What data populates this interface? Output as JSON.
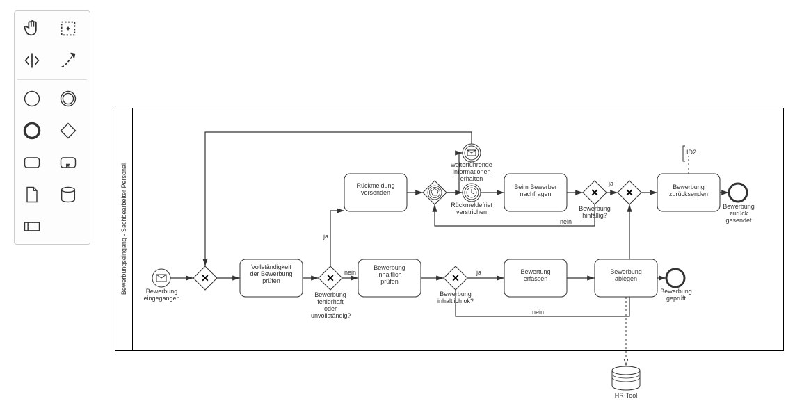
{
  "pool": {
    "title": "Bewerbungseingang -\nSachbearbeiter Personal"
  },
  "events": {
    "start": {
      "label": "Bewerbung\neingegangen"
    },
    "infoReceived": {
      "label": "weiterführende\nInformationen\nerhalten"
    },
    "deadline": {
      "label": "Rückmeldefrist\nverstrichen"
    },
    "endChecked": {
      "label": "Bewerbung\ngeprüft"
    },
    "endSent": {
      "label": "Bewerbung\nzurück\ngesendet"
    }
  },
  "tasks": {
    "checkComplete": "Vollständigkeit\nder Bewerbung\nprüfen",
    "sendFeedback": "Rückmeldung\nversenden",
    "checkContent": "Bewerbung\ninhaltlich\nprüfen",
    "askApplicant": "Beim Bewerber\nnachfragen",
    "recordEval": "Bewertung\nerfassen",
    "file": "Bewerbung\nablegen",
    "sendBack": "Bewerbung\nzurücksenden"
  },
  "gateways": {
    "faulty": {
      "label": "Bewerbung\nfehlerhaft\noder\nunvollständig?",
      "yes": "ja",
      "no": "nein"
    },
    "contentOk": {
      "label": "Bewerbung\ninhaltlich ok?",
      "yes": "ja",
      "no": "nein"
    },
    "hopeless": {
      "label": "Bewerbung\nhinfällig?",
      "yes": "ja",
      "no": "nein"
    }
  },
  "data": {
    "hrtool": "HR-Tool",
    "id2": "ID2"
  },
  "toolbox": [
    "hand",
    "lasso",
    "space",
    "connect",
    "event",
    "event-double",
    "event-bold",
    "gateway",
    "task",
    "subprocess",
    "data-object",
    "data-store",
    "participant"
  ],
  "chart_data": {
    "type": "bpmn",
    "pool": "Bewerbungseingang - Sachbearbeiter Personal",
    "nodes": [
      {
        "id": "start",
        "type": "startEvent",
        "subtype": "message",
        "label": "Bewerbung eingegangen"
      },
      {
        "id": "gw_merge1",
        "type": "exclusiveGateway"
      },
      {
        "id": "t_checkComplete",
        "type": "task",
        "label": "Vollständigkeit der Bewerbung prüfen"
      },
      {
        "id": "gw_faulty",
        "type": "exclusiveGateway",
        "label": "Bewerbung fehlerhaft oder unvollständig?"
      },
      {
        "id": "t_sendFeedback",
        "type": "task",
        "label": "Rückmeldung versenden"
      },
      {
        "id": "gw_event",
        "type": "eventBasedGateway"
      },
      {
        "id": "ev_info",
        "type": "intermediateCatchEvent",
        "subtype": "message",
        "label": "weiterführende Informationen erhalten"
      },
      {
        "id": "ev_deadline",
        "type": "intermediateCatchEvent",
        "subtype": "timer",
        "label": "Rückmeldefrist verstrichen"
      },
      {
        "id": "t_askApplicant",
        "type": "task",
        "label": "Beim Bewerber nachfragen"
      },
      {
        "id": "gw_hopeless",
        "type": "exclusiveGateway",
        "label": "Bewerbung hinfällig?"
      },
      {
        "id": "gw_merge2",
        "type": "exclusiveGateway"
      },
      {
        "id": "t_sendBack",
        "type": "task",
        "label": "Bewerbung zurücksenden"
      },
      {
        "id": "end_sent",
        "type": "endEvent",
        "label": "Bewerbung zurück gesendet"
      },
      {
        "id": "t_checkContent",
        "type": "task",
        "label": "Bewerbung inhaltlich prüfen"
      },
      {
        "id": "gw_contentOk",
        "type": "exclusiveGateway",
        "label": "Bewerbung inhaltlich ok?"
      },
      {
        "id": "t_recordEval",
        "type": "task",
        "label": "Bewertung erfassen"
      },
      {
        "id": "t_file",
        "type": "task",
        "label": "Bewerbung ablegen"
      },
      {
        "id": "end_checked",
        "type": "endEvent",
        "label": "Bewerbung geprüft"
      },
      {
        "id": "ds_hrtool",
        "type": "dataStore",
        "label": "HR-Tool"
      },
      {
        "id": "txt_id2",
        "type": "textAnnotation",
        "label": "ID2"
      }
    ],
    "flows": [
      {
        "from": "start",
        "to": "gw_merge1"
      },
      {
        "from": "gw_merge1",
        "to": "t_checkComplete"
      },
      {
        "from": "t_checkComplete",
        "to": "gw_faulty"
      },
      {
        "from": "gw_faulty",
        "to": "t_sendFeedback",
        "label": "ja"
      },
      {
        "from": "gw_faulty",
        "to": "t_checkContent",
        "label": "nein"
      },
      {
        "from": "t_sendFeedback",
        "to": "gw_event"
      },
      {
        "from": "gw_event",
        "to": "ev_info"
      },
      {
        "from": "gw_event",
        "to": "ev_deadline"
      },
      {
        "from": "ev_info",
        "to": "gw_merge1"
      },
      {
        "from": "ev_deadline",
        "to": "t_askApplicant"
      },
      {
        "from": "t_askApplicant",
        "to": "gw_hopeless"
      },
      {
        "from": "gw_hopeless",
        "to": "gw_merge2",
        "label": "ja"
      },
      {
        "from": "gw_hopeless",
        "to": "gw_event",
        "label": "nein"
      },
      {
        "from": "gw_merge2",
        "to": "t_sendBack"
      },
      {
        "from": "t_sendBack",
        "to": "end_sent"
      },
      {
        "from": "t_checkContent",
        "to": "gw_contentOk"
      },
      {
        "from": "gw_contentOk",
        "to": "t_recordEval",
        "label": "ja"
      },
      {
        "from": "gw_contentOk",
        "to": "gw_merge2",
        "label": "nein"
      },
      {
        "from": "t_recordEval",
        "to": "t_file"
      },
      {
        "from": "t_file",
        "to": "end_checked"
      },
      {
        "from": "t_file",
        "to": "ds_hrtool",
        "type": "dataOutputAssociation"
      },
      {
        "from": "t_sendBack",
        "to": "txt_id2",
        "type": "association"
      }
    ]
  }
}
